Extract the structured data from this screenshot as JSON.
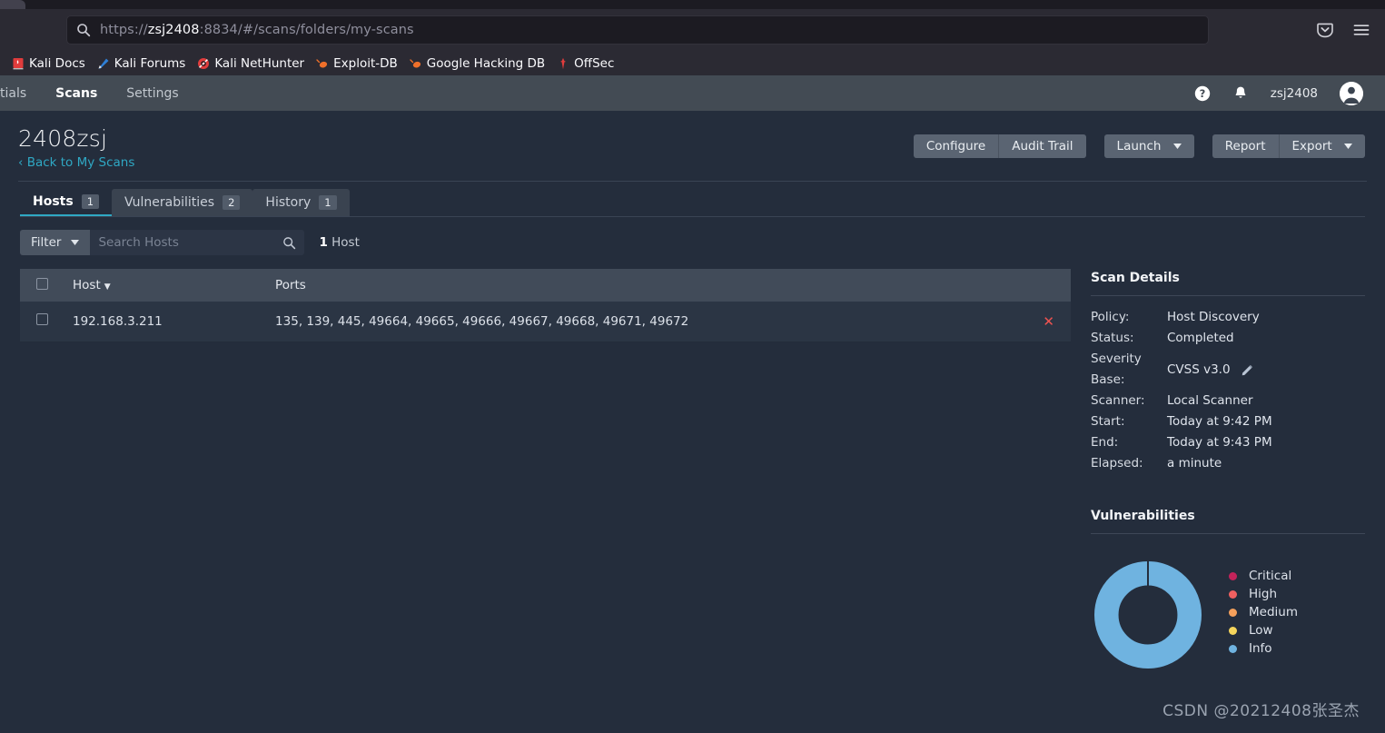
{
  "browser": {
    "url_prefix": "https://",
    "url_host": "zsj2408",
    "url_suffix": ":8834/#/scans/folders/my-scans",
    "url_full": "https://zsj2408:8834/#/scans/folders/my-scans",
    "search_icon": "search-icon",
    "pocket_icon": "pocket-save-icon",
    "menu_icon": "hamburger-menu-icon",
    "bookmarks": [
      {
        "label": "Kali Docs",
        "icon": "kali-docs-icon"
      },
      {
        "label": "Kali Forums",
        "icon": "kali-forums-icon"
      },
      {
        "label": "Kali NetHunter",
        "icon": "kali-nethunter-icon"
      },
      {
        "label": "Exploit-DB",
        "icon": "exploit-db-icon"
      },
      {
        "label": "Google Hacking DB",
        "icon": "google-hacking-db-icon"
      },
      {
        "label": "OffSec",
        "icon": "offsec-icon"
      }
    ]
  },
  "app_nav": {
    "items": [
      {
        "label": "tials",
        "active": false,
        "cut": true
      },
      {
        "label": "Scans",
        "active": true,
        "cut": false
      },
      {
        "label": "Settings",
        "active": false,
        "cut": false
      }
    ],
    "help_icon": "help-circle-icon",
    "notifications_icon": "bell-icon",
    "username": "zsj2408",
    "avatar_icon": "user-avatar-icon"
  },
  "page_head": {
    "title": "2408zsj",
    "back_link": "‹ Back to My Scans",
    "buttons": {
      "configure": "Configure",
      "audit_trail": "Audit Trail",
      "launch": "Launch",
      "report": "Report",
      "export": "Export"
    }
  },
  "tabs": [
    {
      "label": "Hosts",
      "count": "1",
      "active": true
    },
    {
      "label": "Vulnerabilities",
      "count": "2",
      "active": false
    },
    {
      "label": "History",
      "count": "1",
      "active": false
    }
  ],
  "filter_bar": {
    "filter_label": "Filter",
    "search_placeholder": "Search Hosts",
    "search_value": "",
    "search_icon": "search-icon",
    "count_number": "1",
    "count_label": " Host"
  },
  "table": {
    "columns": [
      "Host",
      "Ports"
    ],
    "sort_column": "Host",
    "sort_direction": "desc",
    "rows": [
      {
        "host": "192.168.3.211",
        "ports": "135, 139, 445, 49664, 49665, 49666, 49667, 49668, 49671, 49672",
        "delete_icon": "delete-x-icon"
      }
    ]
  },
  "scan_details": {
    "title": "Scan Details",
    "rows": [
      {
        "label": "Policy:",
        "value": "Host Discovery"
      },
      {
        "label": "Status:",
        "value": "Completed"
      },
      {
        "label": "Severity Base:",
        "value": "CVSS v3.0",
        "edit_icon": "pencil-edit-icon"
      },
      {
        "label": "Scanner:",
        "value": "Local Scanner"
      },
      {
        "label": "Start:",
        "value": "Today at 9:42 PM"
      },
      {
        "label": "End:",
        "value": "Today at 9:43 PM"
      },
      {
        "label": "Elapsed:",
        "value": "a minute"
      }
    ]
  },
  "chart_data": {
    "type": "pie",
    "title": "Vulnerabilities",
    "categories": [
      "Critical",
      "High",
      "Medium",
      "Low",
      "Info"
    ],
    "values": [
      0,
      0,
      0,
      0,
      100
    ],
    "colors": [
      "#c3235a",
      "#f06060",
      "#f5a05c",
      "#f5d55c",
      "#6fb3e0"
    ],
    "legend_position": "right",
    "donut": true,
    "inner_radius_ratio": 0.55
  },
  "watermark": "CSDN @20212408张圣杰",
  "theme": {
    "browser_chrome_bg": "#2b2a33",
    "url_bar_bg": "#1c1b22",
    "app_nav_bg": "#434b54",
    "page_bg": "#242d3c",
    "panel_header_bg": "#414b59",
    "row_bg": "#2b3544",
    "accent_link": "#2fa8c4",
    "button_bg": "#5a6472",
    "danger": "#ef5350"
  }
}
